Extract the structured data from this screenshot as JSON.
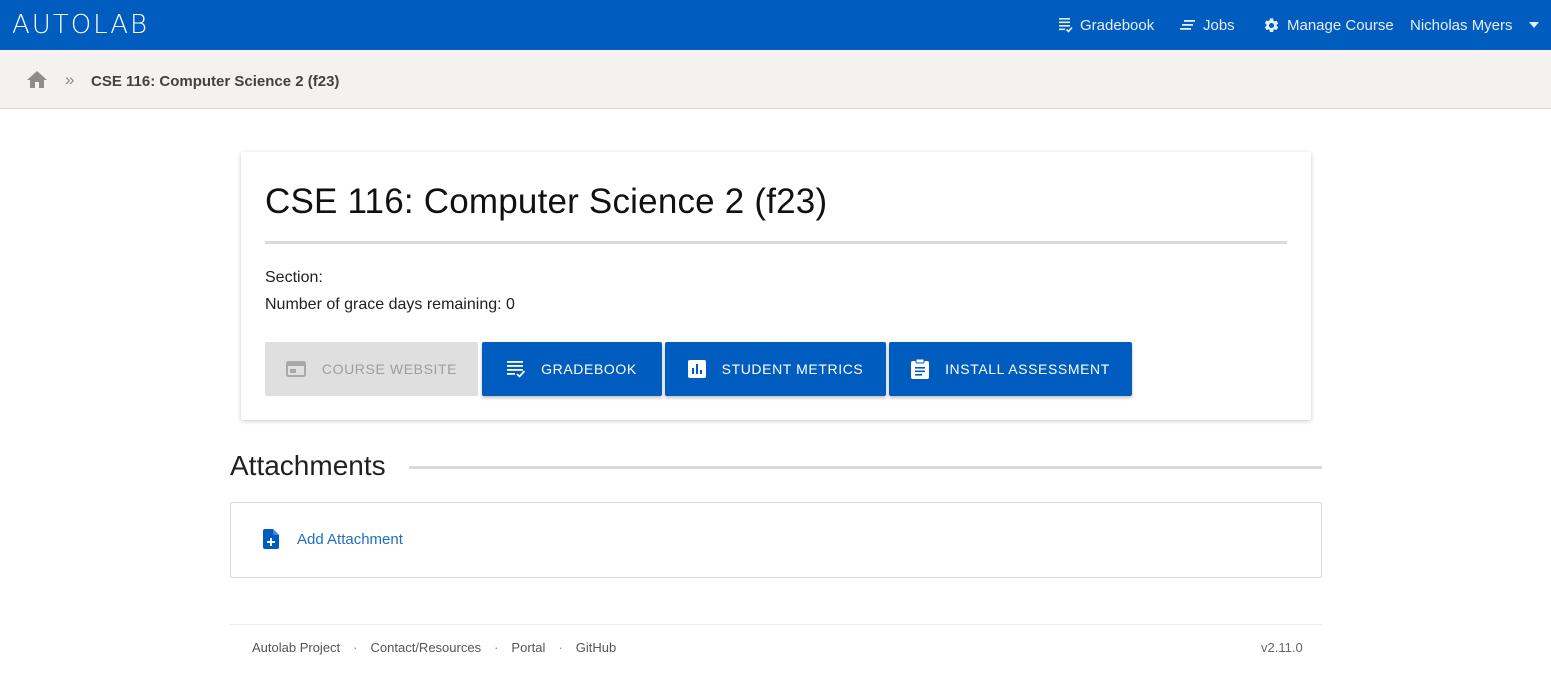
{
  "brand": {
    "logo_text": "AUTOLAB",
    "nav_color": "#005cbf"
  },
  "navbar": {
    "items": [
      {
        "label": "Gradebook",
        "icon": "gradebook-icon"
      },
      {
        "label": "Jobs",
        "icon": "jobs-icon"
      },
      {
        "label": "Manage Course",
        "icon": "gear-icon"
      }
    ],
    "user": {
      "name": "Nicholas Myers",
      "icon": "caret-down-icon"
    }
  },
  "breadcrumb": {
    "separator": "»",
    "current": "CSE 116: Computer Science 2 (f23)",
    "home_icon": "home-icon"
  },
  "course": {
    "title": "CSE 116: Computer Science 2 (f23)",
    "section_label": "Section:",
    "grace_label": "Number of grace days remaining: 0",
    "buttons": [
      {
        "label": "Course Website",
        "icon": "web-window-icon",
        "disabled": true
      },
      {
        "label": "Gradebook",
        "icon": "list-check-icon",
        "disabled": false
      },
      {
        "label": "Student Metrics",
        "icon": "bar-chart-icon",
        "disabled": false
      },
      {
        "label": "Install Assessment",
        "icon": "clipboard-icon",
        "disabled": false
      }
    ]
  },
  "attachments": {
    "heading": "Attachments",
    "add_label": "Add Attachment",
    "add_icon": "file-plus-icon"
  },
  "footer": {
    "links": [
      "Autolab Project",
      "Contact/Resources",
      "Portal",
      "GitHub"
    ],
    "separator": "·",
    "version": "v2.11.0"
  }
}
